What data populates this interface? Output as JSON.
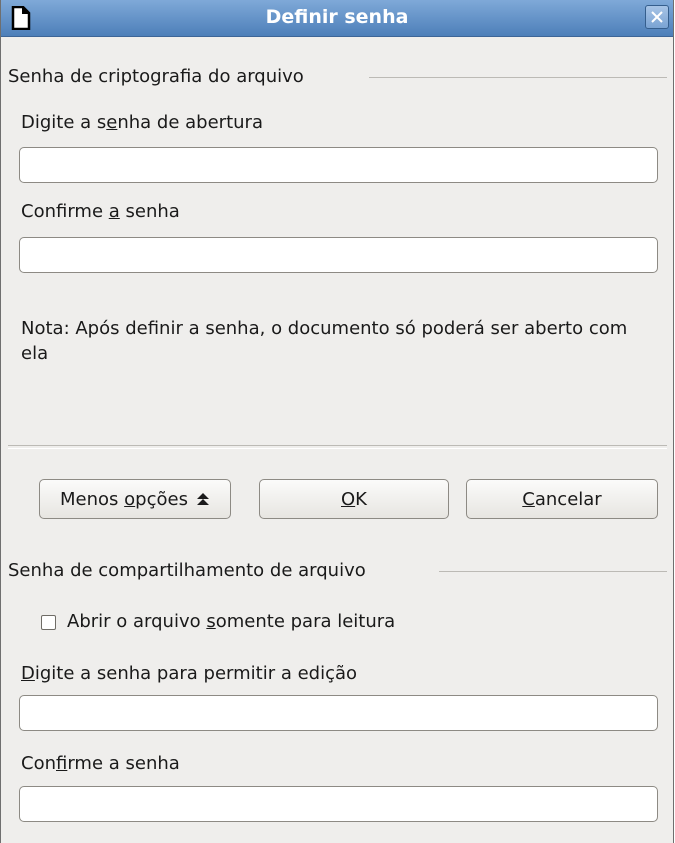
{
  "window": {
    "title": "Definir senha",
    "icon": "document-icon",
    "close_icon": "close-icon"
  },
  "encryption": {
    "section_title": "Senha de criptografia do arquivo",
    "open_password_label": {
      "before": "Digite a s",
      "accel": "e",
      "after": "nha de abertura"
    },
    "open_password_value": "",
    "confirm_label": {
      "before": "Confirme ",
      "accel": "a",
      "after": " senha"
    },
    "confirm_value": "",
    "note": "Nota: Após definir a senha, o documento só poderá ser aberto com ela"
  },
  "buttons": {
    "less_options": {
      "before": "Menos ",
      "accel": "o",
      "after": "pções",
      "icon": "double-up-arrow-icon"
    },
    "ok": {
      "before": "",
      "accel": "O",
      "after": "K"
    },
    "cancel": {
      "before": "",
      "accel": "C",
      "after": "ancelar"
    }
  },
  "sharing": {
    "section_title": "Senha de compartilhamento de arquivo",
    "readonly_checkbox": {
      "before": "Abrir o arquivo ",
      "accel": "s",
      "after": "omente para leitura",
      "checked": false
    },
    "edit_password_label": {
      "before": "",
      "accel": "D",
      "after": "igite a senha para permitir a edição"
    },
    "edit_password_value": "",
    "confirm_label": {
      "before": "Con",
      "accel": "f",
      "after": "irme a senha"
    },
    "confirm_value": ""
  },
  "colors": {
    "titlebar": "#4d7fb9",
    "dialog_bg": "#efeeec",
    "field_border": "#8d8a84"
  }
}
